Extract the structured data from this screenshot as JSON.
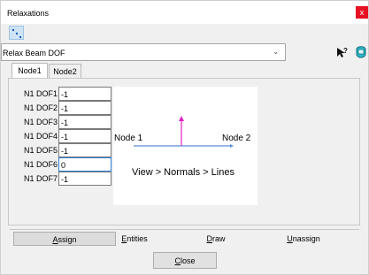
{
  "window": {
    "title": "Relaxations",
    "close_glyph": "x"
  },
  "toolbar": {
    "pick_tool_icon": "pick-line-icon"
  },
  "relaxation_type": {
    "selected": "Relax Beam DOF"
  },
  "icons": {
    "help": "help-pointer-icon",
    "model": "model-view-icon"
  },
  "tabs": [
    {
      "label": "Node1",
      "active": true
    },
    {
      "label": "Node2",
      "active": false
    }
  ],
  "dofs": [
    {
      "label": "N1 DOF1",
      "value": "-1"
    },
    {
      "label": "N1 DOF2",
      "value": "-1"
    },
    {
      "label": "N1 DOF3",
      "value": "-1"
    },
    {
      "label": "N1 DOF4",
      "value": "-1"
    },
    {
      "label": "N1 DOF5",
      "value": "-1"
    },
    {
      "label": "N1 DOF6",
      "value": "0"
    },
    {
      "label": "N1 DOF7",
      "value": "-1"
    }
  ],
  "diagram": {
    "node1": "Node 1",
    "node2": "Node 2",
    "caption": "View > Normals > Lines",
    "line_color": "#5a8fd8",
    "normal_color": "#e020c8"
  },
  "buttons": {
    "assign": {
      "first": "A",
      "rest": "ssign"
    },
    "entities": {
      "first": "E",
      "rest": "ntities"
    },
    "draw": {
      "first": "D",
      "rest": "raw"
    },
    "unassign": {
      "first": "U",
      "rest": "nassign"
    },
    "close": {
      "first": "C",
      "rest": "lose"
    }
  }
}
